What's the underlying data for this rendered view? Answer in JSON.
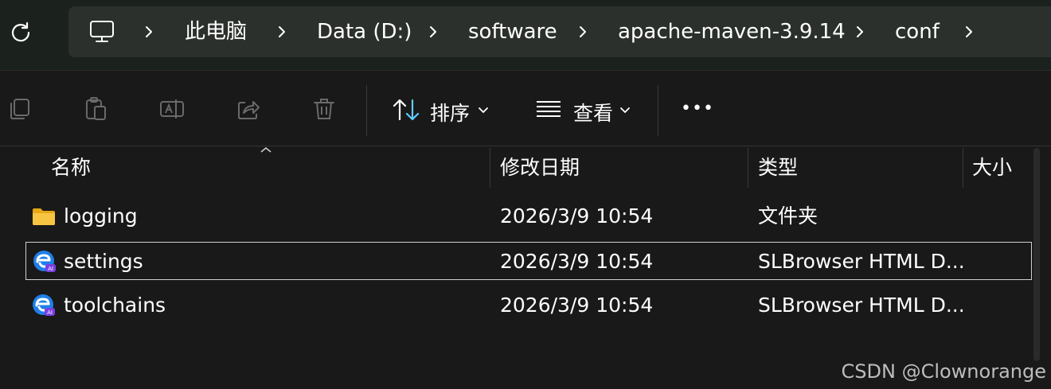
{
  "breadcrumb": {
    "items": [
      "此电脑",
      "Data (D:)",
      "software",
      "apache-maven-3.9.14",
      "conf"
    ]
  },
  "toolbar": {
    "sort_label": "排序",
    "view_label": "查看",
    "more_label": "•••"
  },
  "columns": {
    "name": "名称",
    "date": "修改日期",
    "type": "类型",
    "size": "大小"
  },
  "files": [
    {
      "name": "logging",
      "date": "2026/3/9 10:54",
      "type": "文件夹",
      "icon": "folder-icon"
    },
    {
      "name": "settings",
      "date": "2026/3/9 10:54",
      "type": "SLBrowser HTML D...",
      "icon": "slbrowser-icon"
    },
    {
      "name": "toolchains",
      "date": "2026/3/9 10:54",
      "type": "SLBrowser HTML D...",
      "icon": "slbrowser-icon"
    }
  ],
  "watermark": "CSDN @Clownorange",
  "colors": {
    "accent": "#60cdff",
    "folder": "#f6c443"
  }
}
